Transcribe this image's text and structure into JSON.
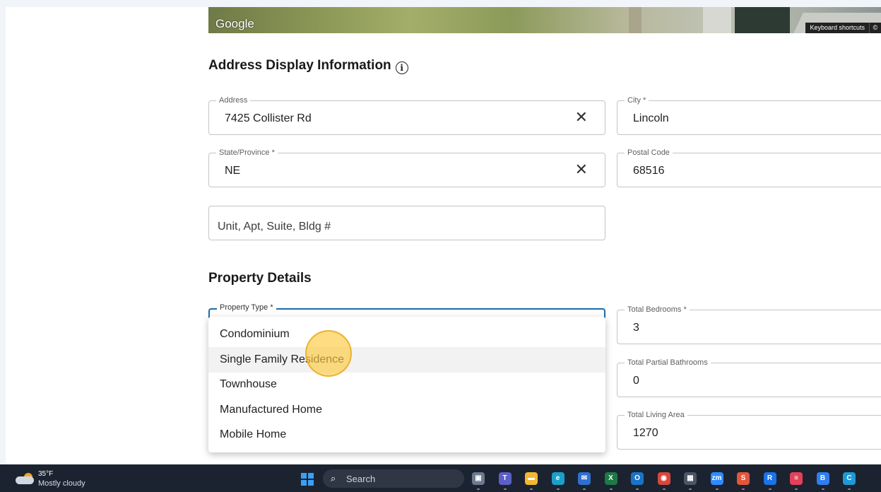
{
  "map": {
    "logo": "Google",
    "keyboard_shortcuts": "Keyboard shortcuts",
    "copyright_glyph": "©"
  },
  "address_section": {
    "title": "Address Display Information",
    "info_glyph": "i",
    "address": {
      "label": "Address",
      "value": "7425 Collister Rd",
      "clear": "✕"
    },
    "city": {
      "label": "City *",
      "value": "Lincoln"
    },
    "state": {
      "label": "State/Province *",
      "value": "NE",
      "clear": "✕"
    },
    "postal": {
      "label": "Postal Code",
      "value": "68516"
    },
    "unit": {
      "placeholder": "Unit, Apt, Suite, Bldg #"
    }
  },
  "property_section": {
    "title": "Property Details",
    "property_type": {
      "label": "Property Type *"
    },
    "bedrooms": {
      "label": "Total Bedrooms *",
      "value": "3"
    },
    "partial_baths": {
      "label": "Total Partial Bathrooms",
      "value": "0"
    },
    "living_area": {
      "label": "Total Living Area",
      "value": "1270"
    },
    "options": [
      "Condominium",
      "Single Family Residence",
      "Townhouse",
      "Manufactured Home",
      "Mobile Home"
    ],
    "highlighted_option": "Single Family Residence"
  },
  "taskbar": {
    "temperature": "35°F",
    "condition": "Mostly cloudy",
    "search_label": "Search",
    "search_glyph": "⌕",
    "apps": [
      {
        "name": "task-view",
        "glyph": "▣",
        "color": "#6b7a8f"
      },
      {
        "name": "teams",
        "glyph": "T",
        "color": "#5b5fc7"
      },
      {
        "name": "file-explorer",
        "glyph": "▬",
        "color": "#f2b930"
      },
      {
        "name": "edge",
        "glyph": "e",
        "color": "#1aa0c9"
      },
      {
        "name": "outlook-mail",
        "glyph": "✉",
        "color": "#2f6fd1"
      },
      {
        "name": "excel",
        "glyph": "X",
        "color": "#1d7a45"
      },
      {
        "name": "outlook",
        "glyph": "O",
        "color": "#1a73c9"
      },
      {
        "name": "chrome",
        "glyph": "◉",
        "color": "#d9463b"
      },
      {
        "name": "calculator",
        "glyph": "▦",
        "color": "#4b5563"
      },
      {
        "name": "zoom",
        "glyph": "zm",
        "color": "#2d8cff"
      },
      {
        "name": "s-app",
        "glyph": "S",
        "color": "#e3563b"
      },
      {
        "name": "r-app",
        "glyph": "R",
        "color": "#1a73e8"
      },
      {
        "name": "red-app",
        "glyph": "≡",
        "color": "#e3415a"
      },
      {
        "name": "b-app",
        "glyph": "B",
        "color": "#2f7ef0"
      },
      {
        "name": "copilot",
        "glyph": "C",
        "color": "#1e9ad6"
      }
    ]
  }
}
